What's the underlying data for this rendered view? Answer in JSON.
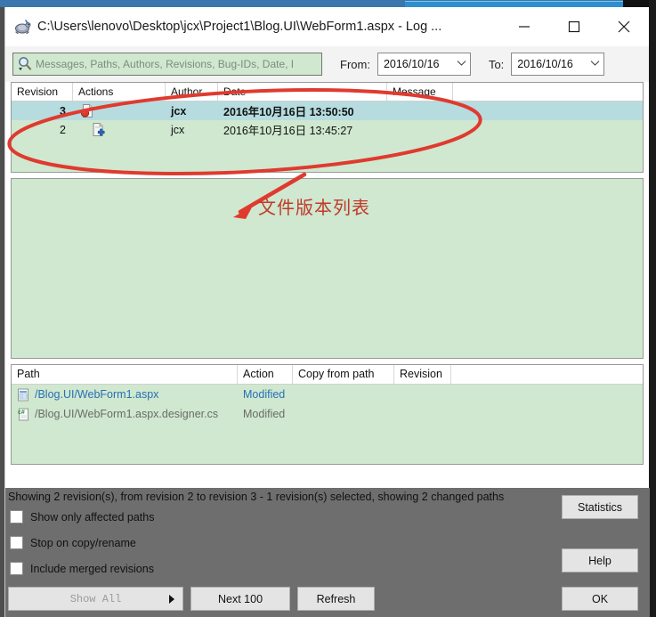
{
  "window": {
    "title": "C:\\Users\\lenovo\\Desktop\\jcx\\Project1\\Blog.UI\\WebForm1.aspx - Log ...",
    "icon": "turtle-icon",
    "minimize_label": "minimize-icon",
    "maximize_label": "maximize-icon",
    "close_label": "close-icon"
  },
  "filter": {
    "search_placeholder": "Messages, Paths, Authors, Revisions, Bug-IDs, Date, I",
    "search_icon": "search-icon",
    "search_value": "",
    "from_label": "From:",
    "from_value": "2016/10/16",
    "to_label": "To:",
    "to_value": "2016/10/16",
    "chevron": "⌄"
  },
  "revisions": {
    "columns": [
      "Revision",
      "Actions",
      "Author",
      "Date",
      "Message"
    ],
    "rows": [
      {
        "revision": "3",
        "action_icon": "modified-file-icon",
        "author": "jcx",
        "date": "2016年10月16日 13:50:50",
        "message": "",
        "selected": true
      },
      {
        "revision": "2",
        "action_icon": "added-file-icon",
        "author": "jcx",
        "date": "2016年10月16日 13:45:27",
        "message": "",
        "selected": false
      }
    ]
  },
  "message_panel": {
    "text": ""
  },
  "paths": {
    "columns": [
      "Path",
      "Action",
      "Copy from path",
      "Revision"
    ],
    "rows": [
      {
        "icon": "aspx-file-icon",
        "path": "/Blog.UI/WebForm1.aspx",
        "action": "Modified",
        "copy_from_path": "",
        "revision": "",
        "color": "#2a6fb5"
      },
      {
        "icon": "csharp-file-icon",
        "path": "/Blog.UI/WebForm1.aspx.designer.cs",
        "action": "Modified",
        "copy_from_path": "",
        "revision": "",
        "color": "#6b6b6b"
      }
    ]
  },
  "status": {
    "text": "Showing 2 revision(s), from revision 2 to revision 3 - 1 revision(s) selected, showing 2 changed paths"
  },
  "checkboxes": [
    {
      "label": "Show only affected paths",
      "checked": false
    },
    {
      "label": "Stop on copy/rename",
      "checked": false
    },
    {
      "label": "Include merged revisions",
      "checked": false
    }
  ],
  "buttons": {
    "show_all": "Show All",
    "next_100": "Next 100",
    "refresh": "Refresh",
    "statistics": "Statistics",
    "help": "Help",
    "ok": "OK"
  },
  "annotation": {
    "text": "文件版本列表",
    "color": "#c0392b",
    "ellipse_label": "red-ellipse-highlight",
    "arrow_label": "red-arrow-pointer"
  },
  "colors": {
    "list_background": "#cfe8cf",
    "selected_row": "#b6dcdf",
    "dialog_background": "#6e6e6e",
    "annotation_red": "#c0392b",
    "title_blue": "#3b77ad"
  }
}
